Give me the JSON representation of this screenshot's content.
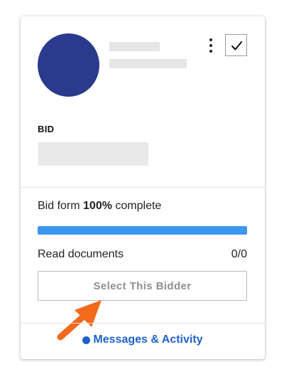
{
  "card": {
    "bid_label": "BID",
    "progress": {
      "prefix": "Bid form ",
      "percent_text": "100%",
      "suffix": " complete",
      "fraction": 1.0
    },
    "documents": {
      "label": "Read documents",
      "count": "0/0"
    },
    "select_button": "Select This Bidder",
    "messages_link": "Messages & Activity"
  },
  "colors": {
    "avatar": "#2b3a8c",
    "progress_fill": "#3d97f1",
    "link": "#1e62c9",
    "arrow": "#f26a1b"
  },
  "icons": {
    "menu": "kebab-menu-icon",
    "checkbox": "checkmark-icon",
    "status": "status-dot-icon",
    "annotation": "arrow-icon"
  }
}
